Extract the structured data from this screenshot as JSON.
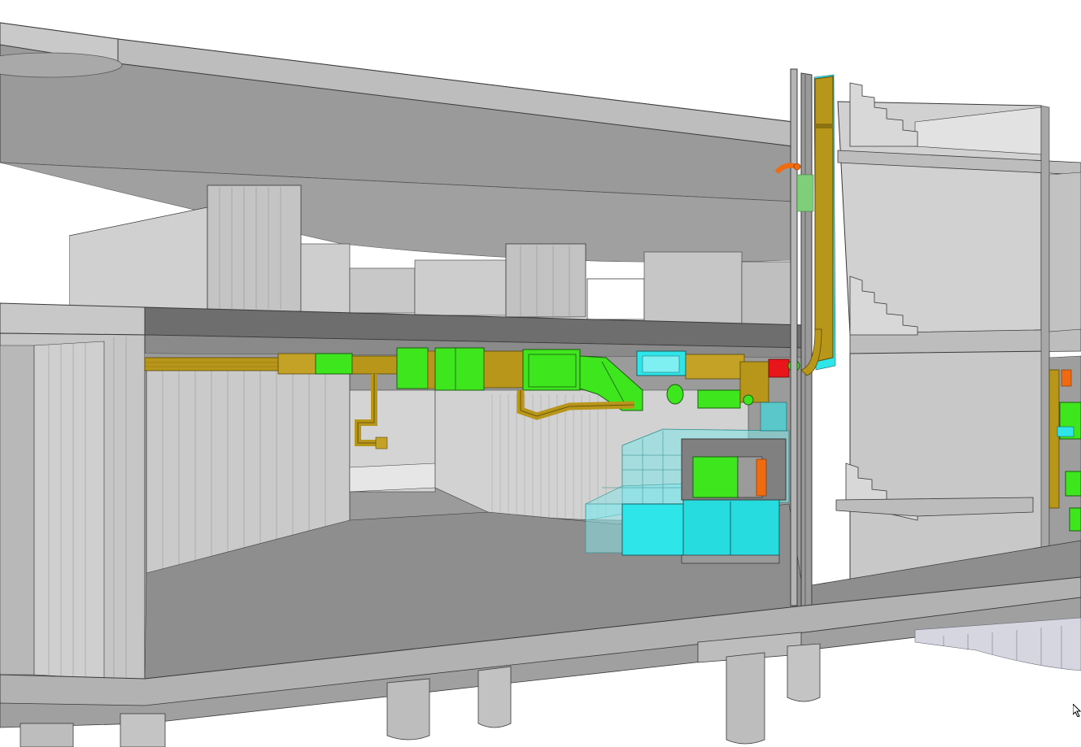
{
  "viewer": {
    "background": "#ffffff"
  },
  "palette": {
    "concrete_light": "#d6d6d6",
    "concrete_mid": "#b3b3b3",
    "concrete_dark": "#7f7f7f",
    "floor": "#8e8e8e",
    "slab_edge": "#a5a5a5",
    "duct_gold": "#b8961a",
    "duct_gold_dark": "#8c7210",
    "equipment_green": "#3ee61e",
    "equipment_cyan": "#2ee6ea",
    "accent_orange": "#f06a10",
    "accent_red": "#e8161a",
    "edge": "#3a3a3a"
  },
  "icons": {
    "cursor": "mouse-pointer-icon"
  }
}
